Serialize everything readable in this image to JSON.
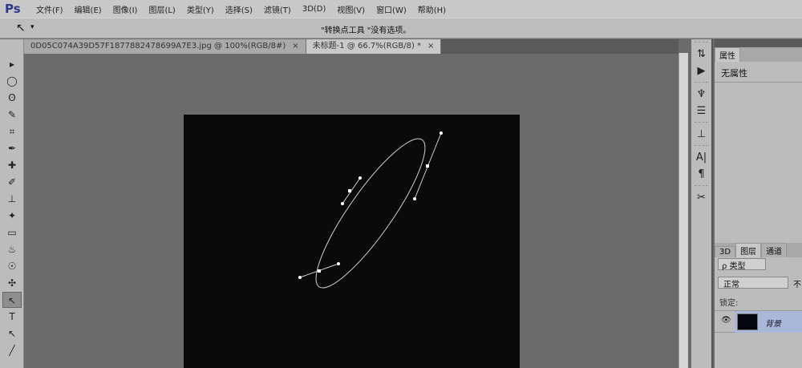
{
  "app": {
    "logo": "Ps"
  },
  "menu": [
    "文件(F)",
    "编辑(E)",
    "图像(I)",
    "图层(L)",
    "类型(Y)",
    "选择(S)",
    "滤镜(T)",
    "3D(D)",
    "视图(V)",
    "窗口(W)",
    "帮助(H)"
  ],
  "options": {
    "tool_glyph": "↖",
    "dropdown": "▾",
    "hint": "\"转换点工具 \"没有选项。"
  },
  "tabs": [
    {
      "label": "0D05C074A39D57F1877882478699A7E3.jpg @ 100%(RGB/8#)",
      "close": "×"
    },
    {
      "label": "未标题-1 @ 66.7%(RGB/8) *",
      "close": "×"
    }
  ],
  "tools": [
    "▸",
    "◯",
    "ʘ",
    "✎",
    "⌗",
    "✒",
    "✚",
    "✐",
    "⊥",
    "✦",
    "▭",
    "♨",
    "☉",
    "✣",
    "↖",
    "T",
    "↖",
    "╱",
    "◯"
  ],
  "side_icons": [
    "⇅",
    "▶",
    "♆",
    "☰",
    "⊥",
    "A|",
    "¶",
    "✂"
  ],
  "properties": {
    "tab": "属性",
    "text": "无属性"
  },
  "layers": {
    "tabs": [
      "3D",
      "图层",
      "通道"
    ],
    "filter": "ρ 类型",
    "blend": "正常",
    "opacity_label": "不",
    "lock_label": "锁定:",
    "layer_name": "背景",
    "eye": "👁"
  }
}
